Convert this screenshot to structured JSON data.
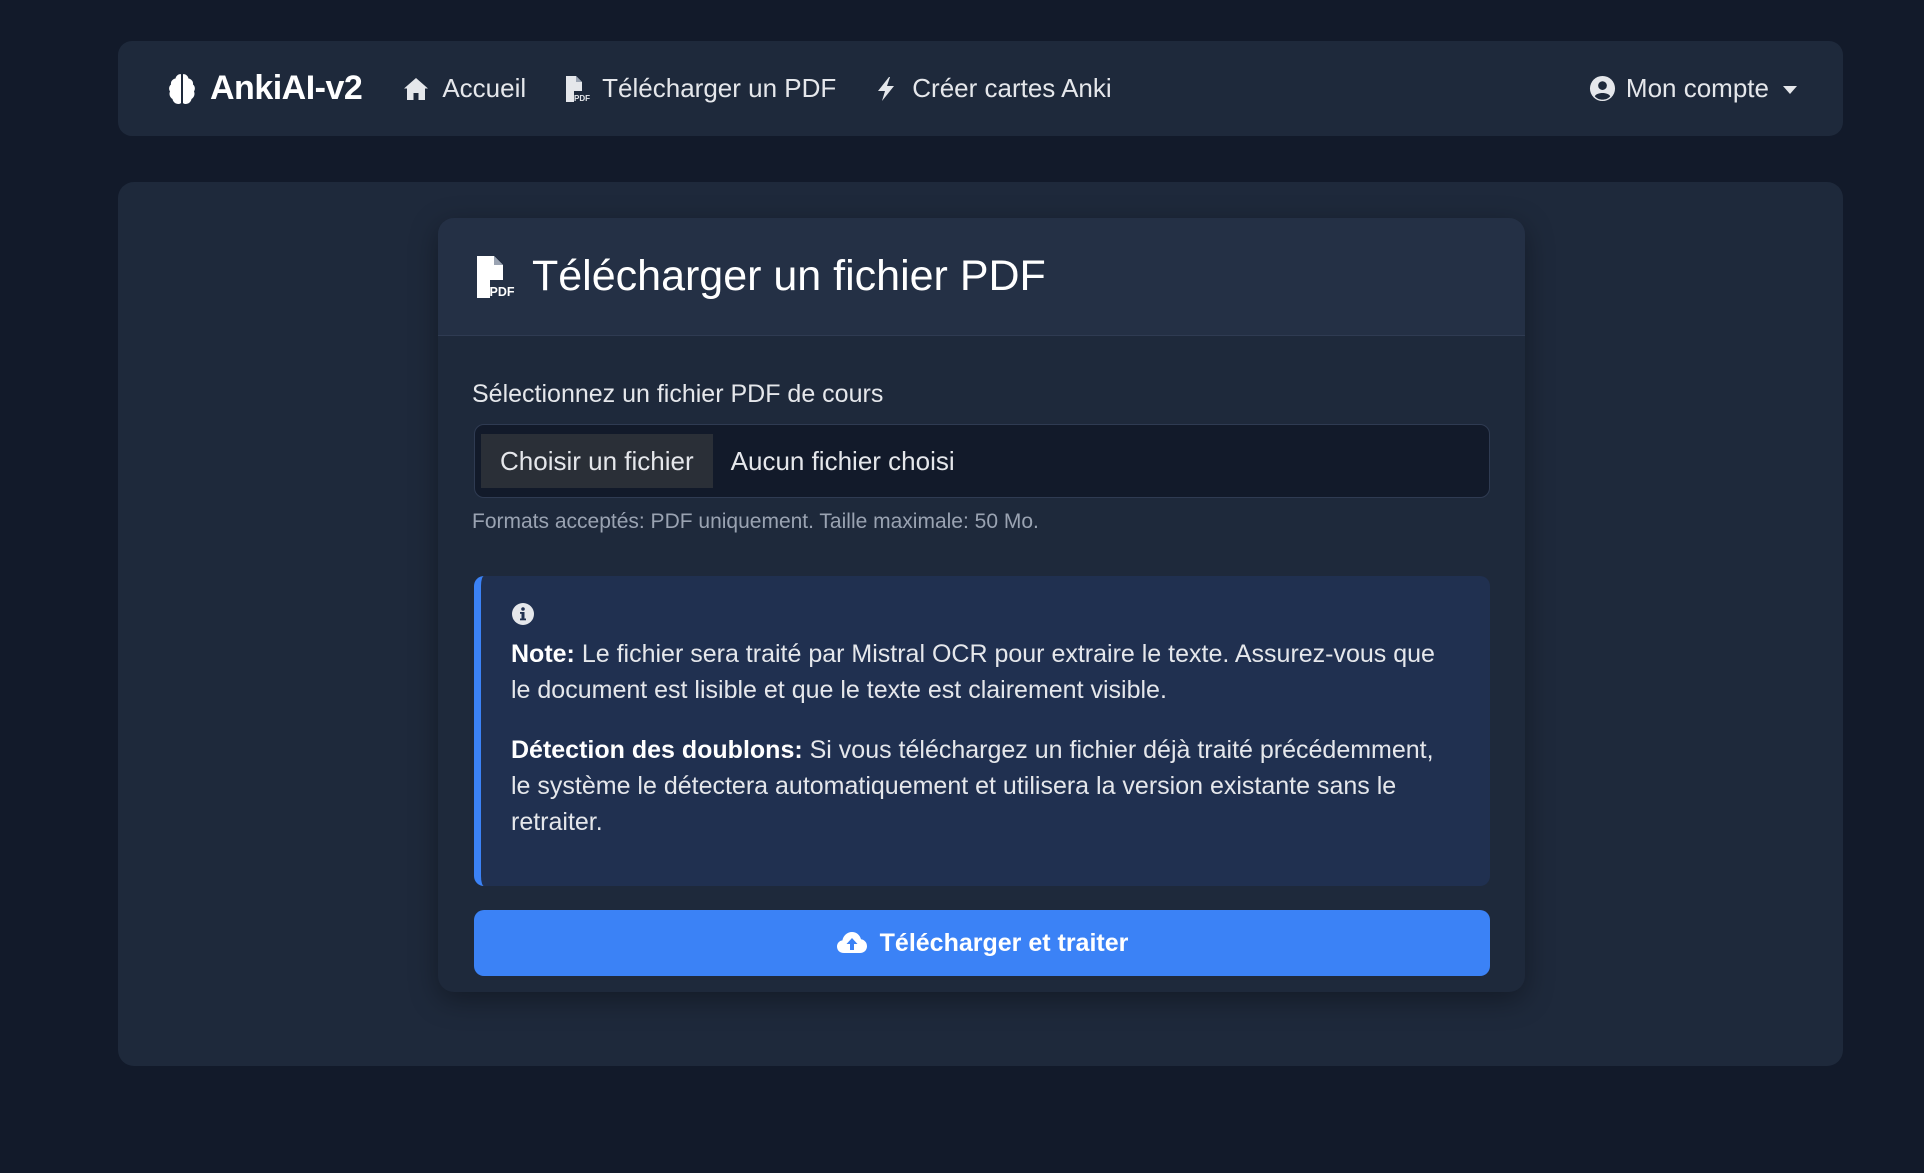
{
  "navbar": {
    "brand": "AnkiAI-v2",
    "links": [
      {
        "label": "Accueil",
        "icon": "home-icon"
      },
      {
        "label": "Télécharger un PDF",
        "icon": "file-pdf-icon"
      },
      {
        "label": "Créer cartes Anki",
        "icon": "bolt-icon"
      }
    ],
    "account_label": "Mon compte"
  },
  "card": {
    "title": "Télécharger un fichier PDF",
    "field_label": "Sélectionnez un fichier PDF de cours",
    "file_button": "Choisir un fichier",
    "file_status": "Aucun fichier choisi",
    "help_text": "Formats acceptés: PDF uniquement. Taille maximale: 50 Mo.",
    "alert": {
      "note_label": "Note:",
      "note_text": " Le fichier sera traité par Mistral OCR pour extraire le texte. Assurez-vous que le document est lisible et que le texte est clairement visible.",
      "dup_label": "Détection des doublons:",
      "dup_text": " Si vous téléchargez un fichier déjà traité précédemment, le système le détectera automatiquement et utilisera la version existante sans le retraiter."
    },
    "submit_label": "Télécharger et traiter"
  },
  "colors": {
    "background": "#121a2a",
    "panel": "#1e293b",
    "accent": "#3b82f6",
    "alert_bg": "#203050"
  }
}
